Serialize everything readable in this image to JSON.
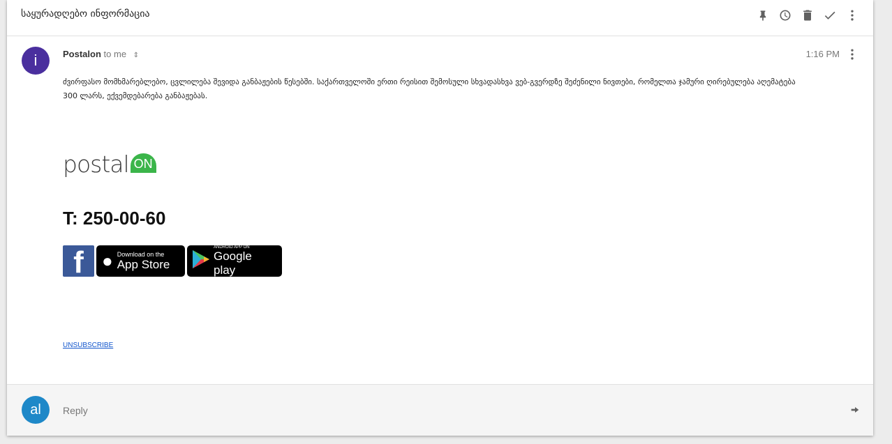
{
  "header": {
    "subject": "საყურადღებო ინფორმაცია",
    "tools": [
      "pin-icon",
      "snooze-icon",
      "trash-icon",
      "done-icon",
      "more-icon"
    ]
  },
  "message": {
    "avatar_letter": "i",
    "avatar_color": "#4a2f9e",
    "sender": "Postalon",
    "recipient": "to me",
    "time": "1:16 PM",
    "body": "ძვირფასო მომხმარებლებო, ცვლილება შევიდა განბაჟების წესებში. საქართველოში ერთი რეისით შემოსული სხვადასხვა ვებ-გვერდზე შეძენილი ნივთები, რომელთა ჯამური ღირებულება აღემატება 300 ლარს, ექვემდებარება განბაჟებას.",
    "logo": {
      "text": "postal",
      "badge": "ON",
      "color": "#3bb54a"
    },
    "phone": "T: 250-00-60",
    "badges": {
      "facebook": "f",
      "appstore_small": "Download on the",
      "appstore_big": "App Store",
      "google_small": "ANDROID APP ON",
      "google_big": "Google play"
    },
    "unsubscribe": "UNSUBSCRIBE"
  },
  "reply": {
    "avatar_letter": "al",
    "avatar_color": "#1e88c8",
    "placeholder": "Reply"
  }
}
